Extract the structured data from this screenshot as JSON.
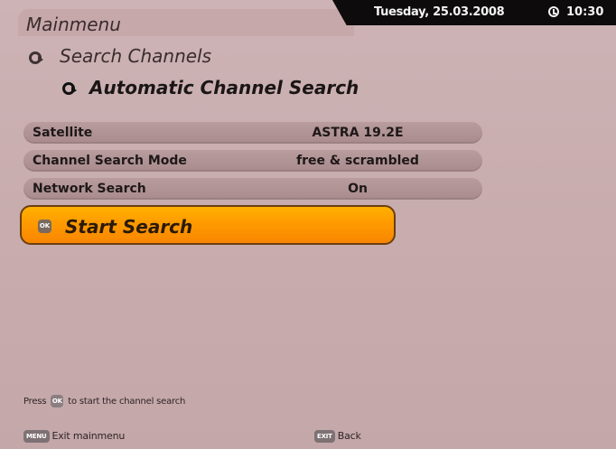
{
  "header": {
    "date": "Tuesday, 25.03.2008",
    "time": "10:30",
    "title": "Mainmenu"
  },
  "breadcrumb": {
    "level1": "Search Channels",
    "level2": "Automatic Channel Search"
  },
  "settings": [
    {
      "label": "Satellite",
      "value": "ASTRA 19.2E"
    },
    {
      "label": "Channel Search Mode",
      "value": "free & scrambled"
    },
    {
      "label": "Network Search",
      "value": "On"
    }
  ],
  "start_button": {
    "label": "Start Search",
    "key": "OK"
  },
  "hint": {
    "prefix": "Press",
    "key": "OK",
    "suffix": "to start the channel search"
  },
  "footer": {
    "menu_key": "MENU",
    "menu_label": "Exit mainmenu",
    "exit_key": "EXIT",
    "exit_label": "Back"
  },
  "colors": {
    "background": "#cbb0b2",
    "highlight": "#ffa000",
    "row": "#b09496"
  }
}
